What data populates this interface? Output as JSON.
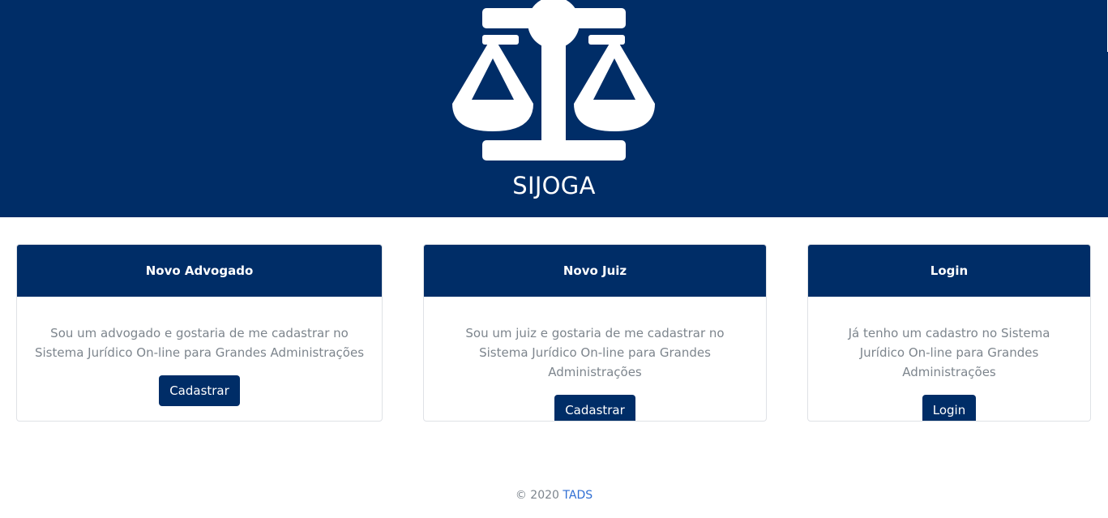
{
  "header": {
    "brand": "SIJOGA",
    "logo_icon": "scales-of-justice-icon"
  },
  "cards": [
    {
      "title": "Novo Advogado",
      "text": "Sou um advogado e gostaria de me cadastrar no Sistema Jurídico On-line para Grandes Administrações",
      "button": "Cadastrar"
    },
    {
      "title": "Novo Juiz",
      "text": "Sou um juiz e gostaria de me cadastrar no Sistema Jurídico On-line para Grandes Administrações",
      "button": "Cadastrar"
    },
    {
      "title": "Login",
      "text": "Já tenho um cadastro no Sistema Jurídico On-line para Grandes Administrações",
      "button": "Login"
    }
  ],
  "footer": {
    "copyright": "© 2020",
    "link": "TADS"
  },
  "colors": {
    "primary": "#002d67",
    "muted_text": "#7d858d",
    "link": "#2f6ed3"
  }
}
